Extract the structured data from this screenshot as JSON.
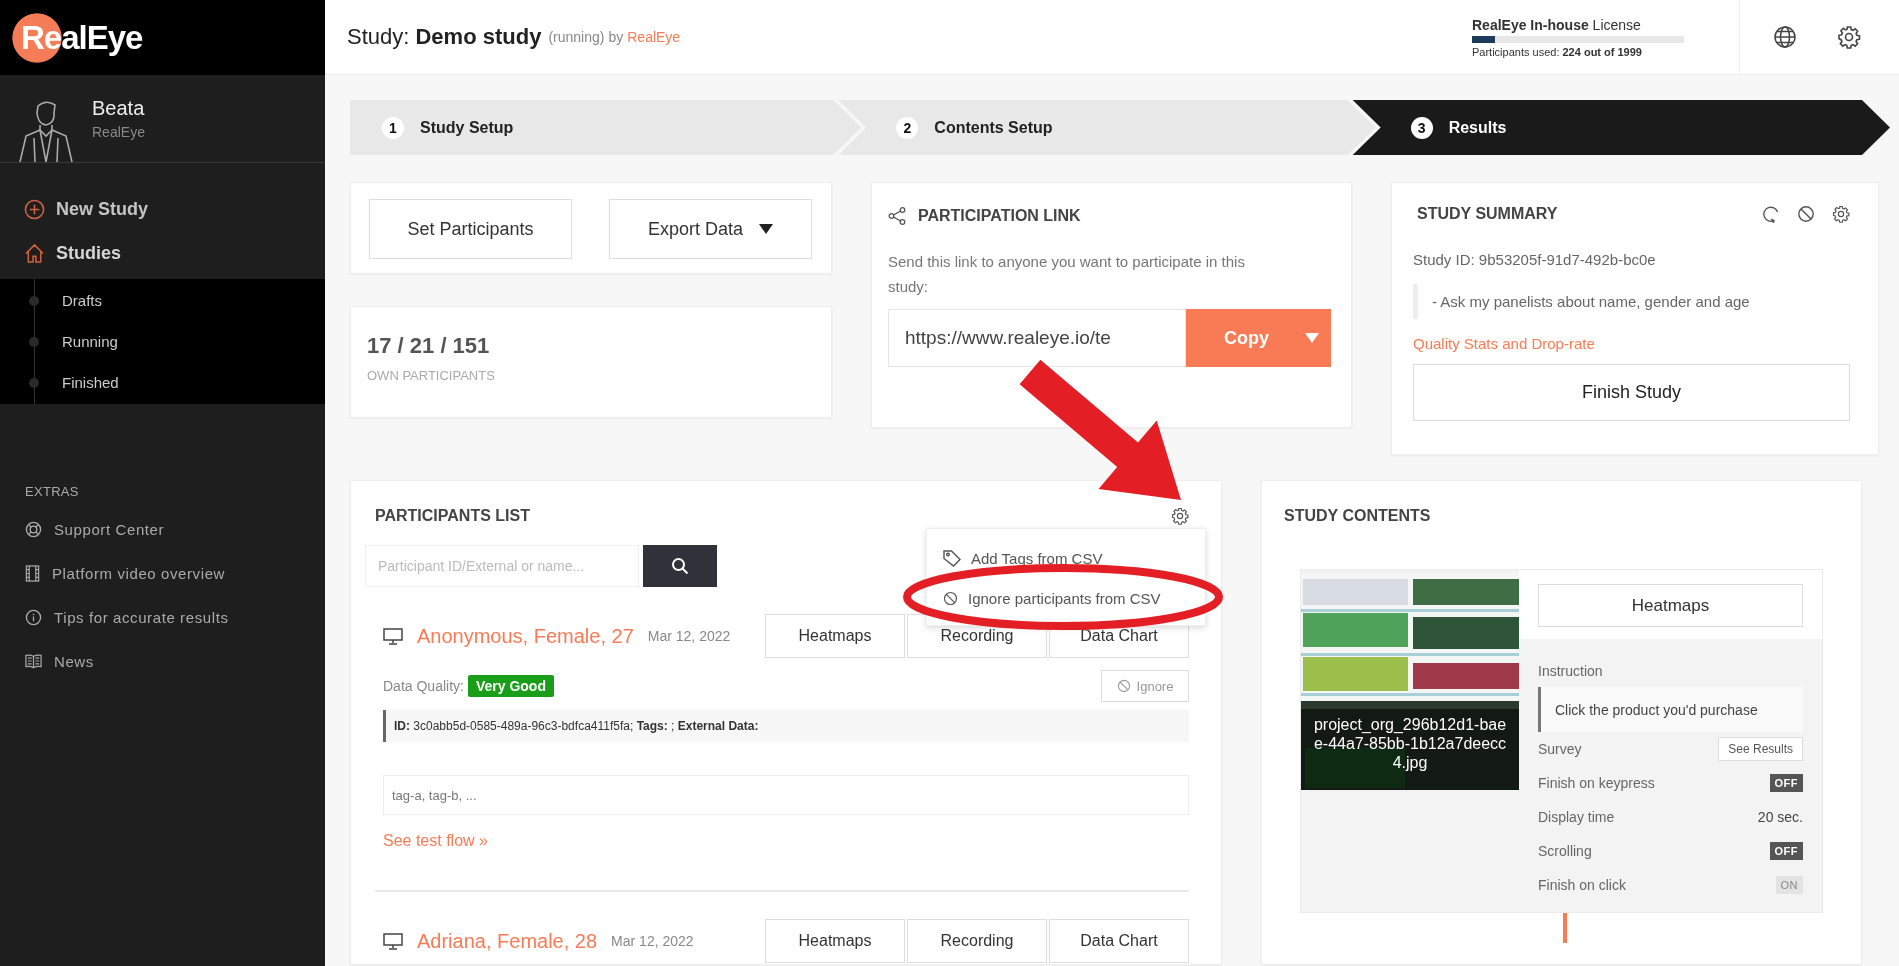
{
  "sidebar": {
    "logo": "RealEye",
    "user": {
      "name": "Beata",
      "org": "RealEye"
    },
    "nav": [
      {
        "label": "New Study"
      },
      {
        "label": "Studies",
        "expanded": true,
        "children": [
          {
            "label": "Drafts"
          },
          {
            "label": "Running"
          },
          {
            "label": "Finished"
          }
        ]
      }
    ],
    "extras_heading": "EXTRAS",
    "extras": [
      {
        "label": "Support Center"
      },
      {
        "label": "Platform video overview"
      },
      {
        "label": "Tips for accurate results"
      },
      {
        "label": "News"
      }
    ]
  },
  "header": {
    "title": "Study: **Demo study**",
    "status": "(running)",
    "by": "by",
    "owner": "RealEye",
    "license": {
      "name": "**RealEye In-house** License",
      "level": 0.11,
      "used": "Participants used: **224 out of 1999**"
    }
  },
  "steps": [
    {
      "number": "1",
      "label": "Study Setup",
      "selected": false
    },
    {
      "number": "2",
      "label": "Contents Setup",
      "selected": false
    },
    {
      "number": "3",
      "label": "Results",
      "selected": true
    }
  ],
  "actions": [
    {
      "label": "Set Participants",
      "dropdown": false
    },
    {
      "label": "Export Data",
      "dropdown": true
    }
  ],
  "stats": {
    "value": "17 / 21 / 151",
    "label": "OWN PARTICIPANTS"
  },
  "participation_link": {
    "title": "PARTICIPATION LINK",
    "description": "Send this link to anyone you want to participate in this study:",
    "url": "https://www.realeye.io/te",
    "copy": "Copy"
  },
  "summary": {
    "title": "STUDY SUMMARY",
    "study_id": "Study ID: 9b53205f-91d7-492b-bc0e",
    "note": "- Ask my panelists about name, gender and age",
    "link": "Quality Stats and Drop-rate",
    "finish": "Finish Study"
  },
  "participants": {
    "title": "PARTICIPANTS LIST",
    "search": {
      "placeholder": "Participant ID/External or name..."
    },
    "menu": {
      "open": true,
      "items": [
        "Add Tags from CSV",
        "Ignore participants from CSV"
      ]
    },
    "rows": [
      {
        "name": "Anonymous, Female, 27",
        "date": "Mar 12, 2022",
        "buttons": [
          "Heatmaps",
          "Recording",
          "Data Chart"
        ],
        "quality_label": "Data Quality:",
        "quality": "Very Good",
        "ignore": "Ignore",
        "info": "**ID:** 3c0abb5d-0585-489a-96c3-bdfca411f5fa; **Tags:** ; **External Data:**",
        "tags": {
          "placeholder": "tag-a, tag-b, ..."
        },
        "flow_link": "See test flow »"
      },
      {
        "name": "Adriana, Female, 28",
        "date": "Mar 12, 2022",
        "buttons": [
          "Heatmaps",
          "Recording",
          "Data Chart"
        ]
      }
    ]
  },
  "contents": {
    "title": "STUDY CONTENTS",
    "items": [
      {
        "image": {
          "kind": "picture",
          "caption": "project_org_296b12d1-baee-44a7-85bb-1b12a7deecc4.jpg"
        },
        "heatmaps": "Heatmaps",
        "instruction_label": "Instruction",
        "instruction": "Click the product you'd purchase",
        "settings": [
          {
            "kind": "button",
            "label": "Survey",
            "button": "See Results"
          },
          {
            "kind": "toggle",
            "label": "Finish on keypress",
            "on": false,
            "text": "OFF"
          },
          {
            "kind": "value",
            "label": "Display time",
            "value": "20 sec."
          },
          {
            "kind": "toggle",
            "label": "Scrolling",
            "on": false,
            "text": "OFF"
          },
          {
            "kind": "toggle",
            "label": "Finish on click",
            "on": true,
            "text": "ON"
          }
        ]
      }
    ]
  },
  "annotations": {
    "arrow": true,
    "ellipse": true
  }
}
